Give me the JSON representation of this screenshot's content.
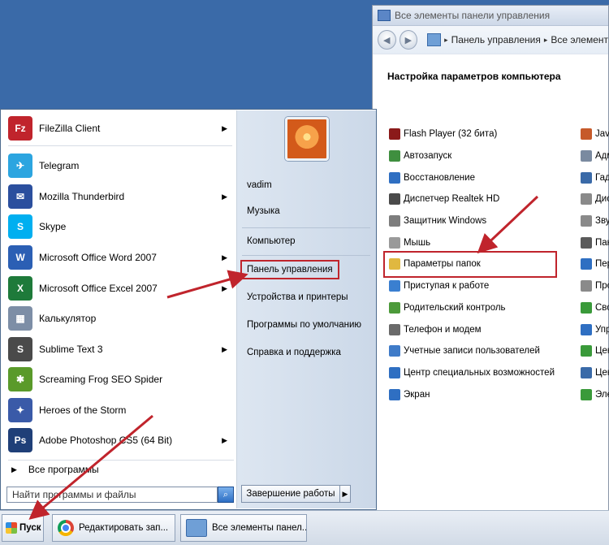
{
  "control_panel": {
    "title": "Все элементы панели управления",
    "breadcrumb": [
      "Панель управления",
      "Все элемент"
    ],
    "heading": "Настройка параметров компьютера",
    "column1": [
      {
        "label": "Flash Player (32 бита)",
        "icon": "flash-icon",
        "color": "#8b1a1a"
      },
      {
        "label": "Автозапуск",
        "icon": "autoplay-icon",
        "color": "#3f8f3f"
      },
      {
        "label": "Восстановление",
        "icon": "recovery-icon",
        "color": "#2f6fc2"
      },
      {
        "label": "Диспетчер Realtek HD",
        "icon": "realtek-icon",
        "color": "#4a4a4a"
      },
      {
        "label": "Защитник Windows",
        "icon": "defender-icon",
        "color": "#7d7d7d"
      },
      {
        "label": "Мышь",
        "icon": "mouse-icon",
        "color": "#9a9a9a"
      },
      {
        "label": "Параметры папок",
        "icon": "folder-options-icon",
        "color": "#e0b840"
      },
      {
        "label": "Приступая к работе",
        "icon": "getting-started-icon",
        "color": "#3a7fd0"
      },
      {
        "label": "Родительский контроль",
        "icon": "parental-control-icon",
        "color": "#4c9a3a"
      },
      {
        "label": "Телефон и модем",
        "icon": "phone-modem-icon",
        "color": "#6a6a6a"
      },
      {
        "label": "Учетные записи пользователей",
        "icon": "user-accounts-icon",
        "color": "#3f7bc8"
      },
      {
        "label": "Центр специальных возможностей",
        "icon": "accessibility-icon",
        "color": "#2f6fc2"
      },
      {
        "label": "Экран",
        "icon": "display-icon",
        "color": "#2f6fc2"
      }
    ],
    "column2": [
      {
        "label": "Jav",
        "color": "#c65a2a"
      },
      {
        "label": "Адм",
        "color": "#7a8aa0"
      },
      {
        "label": "Гад",
        "color": "#3a6aa8"
      },
      {
        "label": "Дис",
        "color": "#8a8a8a"
      },
      {
        "label": "Зву",
        "color": "#8a8a8a"
      },
      {
        "label": "Пан",
        "color": "#5a5a5a"
      },
      {
        "label": "Пер",
        "color": "#2f6fc2"
      },
      {
        "label": "Про",
        "color": "#8a8a8a"
      },
      {
        "label": "Сво",
        "color": "#3a9a3a"
      },
      {
        "label": "Упр",
        "color": "#2f6fc2"
      },
      {
        "label": "Цен",
        "color": "#3a9a3a"
      },
      {
        "label": "Цен",
        "color": "#3a6aa8"
      },
      {
        "label": "Эле",
        "color": "#3a9a3a"
      }
    ]
  },
  "start_menu": {
    "programs": [
      {
        "label": "FileZilla Client",
        "icon": "filezilla-icon",
        "glyph": "Fz",
        "color": "#c0242c",
        "has_arrow": true
      },
      {
        "label": "Telegram",
        "icon": "telegram-icon",
        "glyph": "✈",
        "color": "#2ca5e0",
        "has_arrow": false
      },
      {
        "label": "Mozilla Thunderbird",
        "icon": "thunderbird-icon",
        "glyph": "✉",
        "color": "#2b4f9e",
        "has_arrow": true
      },
      {
        "label": "Skype",
        "icon": "skype-icon",
        "glyph": "S",
        "color": "#00aff0",
        "has_arrow": false
      },
      {
        "label": "Microsoft Office Word 2007",
        "icon": "word-icon",
        "glyph": "W",
        "color": "#2b5fb4",
        "has_arrow": true
      },
      {
        "label": "Microsoft Office Excel 2007",
        "icon": "excel-icon",
        "glyph": "X",
        "color": "#1e7a3a",
        "has_arrow": true
      },
      {
        "label": "Калькулятор",
        "icon": "calculator-icon",
        "glyph": "▦",
        "color": "#7d8ea6",
        "has_arrow": false
      },
      {
        "label": "Sublime Text 3",
        "icon": "sublime-icon",
        "glyph": "S",
        "color": "#4a4a4a",
        "has_arrow": true
      },
      {
        "label": "Screaming Frog SEO Spider",
        "icon": "screaming-frog-icon",
        "glyph": "✱",
        "color": "#5a9a2a",
        "has_arrow": false
      },
      {
        "label": "Heroes of the Storm",
        "icon": "heroes-storm-icon",
        "glyph": "✦",
        "color": "#3a5aa8",
        "has_arrow": false
      },
      {
        "label": "Adobe Photoshop CS5 (64 Bit)",
        "icon": "photoshop-icon",
        "glyph": "Ps",
        "color": "#1f3f78",
        "has_arrow": true
      }
    ],
    "all_programs": "Все программы",
    "search_placeholder": "Найти программы и файлы",
    "right_items": {
      "user": "vadim",
      "music": "Музыка",
      "computer": "Компьютер",
      "control_panel": "Панель управления",
      "devices": "Устройства и принтеры",
      "default_programs": "Программы по умолчанию",
      "help": "Справка и поддержка"
    },
    "shutdown": "Завершение работы"
  },
  "taskbar": {
    "start": "Пуск",
    "chrome_task": "Редактировать зап...",
    "cp_task": "Все элементы панел..."
  },
  "colors": {
    "annotation_red": "#c0242c",
    "desktop": "#3a6aa8"
  }
}
